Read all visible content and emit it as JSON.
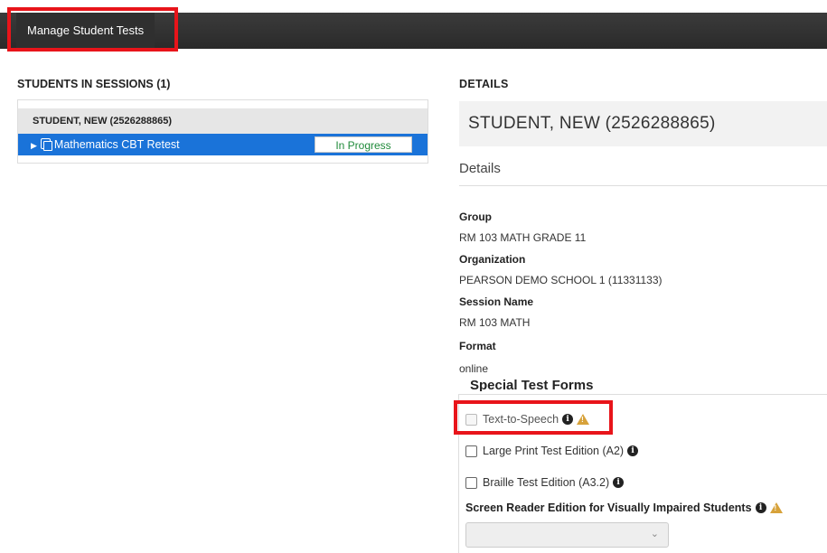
{
  "header": {
    "tab_label": "Manage Student Tests"
  },
  "students_panel": {
    "heading": "STUDENTS IN SESSIONS (1)",
    "student_name": "STUDENT, NEW (2526288865)",
    "test_name": "Mathematics CBT Retest",
    "test_status": "In Progress"
  },
  "details": {
    "heading": "DETAILS",
    "student_title": "STUDENT, NEW (2526288865)",
    "subheading": "Details",
    "fields": [
      {
        "label": "Group",
        "value": "RM 103 MATH GRADE 11"
      },
      {
        "label": "Organization",
        "value": "PEARSON DEMO SCHOOL 1 (11331133)"
      },
      {
        "label": "Session Name",
        "value": "RM 103 MATH"
      },
      {
        "label": "Format",
        "value": "online"
      }
    ]
  },
  "special_test_forms": {
    "legend": "Special Test Forms",
    "options": [
      {
        "label": "Text-to-Speech",
        "checked": false,
        "disabled": true
      },
      {
        "label": "Large Print Test Edition (A2)",
        "checked": false,
        "disabled": false
      },
      {
        "label": "Braille Test Edition (A3.2)",
        "checked": false,
        "disabled": false
      }
    ],
    "screen_reader_label": "Screen Reader Edition for Visually Impaired Students",
    "screen_reader_value": ""
  },
  "colors": {
    "highlight": "#e8141a",
    "selected_row": "#1a73d9",
    "status_text": "#1f8a3a",
    "warning": "#d7a23a"
  },
  "icons": [
    "info-icon",
    "warning-icon",
    "chevron-down-icon",
    "caret-right-icon",
    "copy-document-icon"
  ]
}
